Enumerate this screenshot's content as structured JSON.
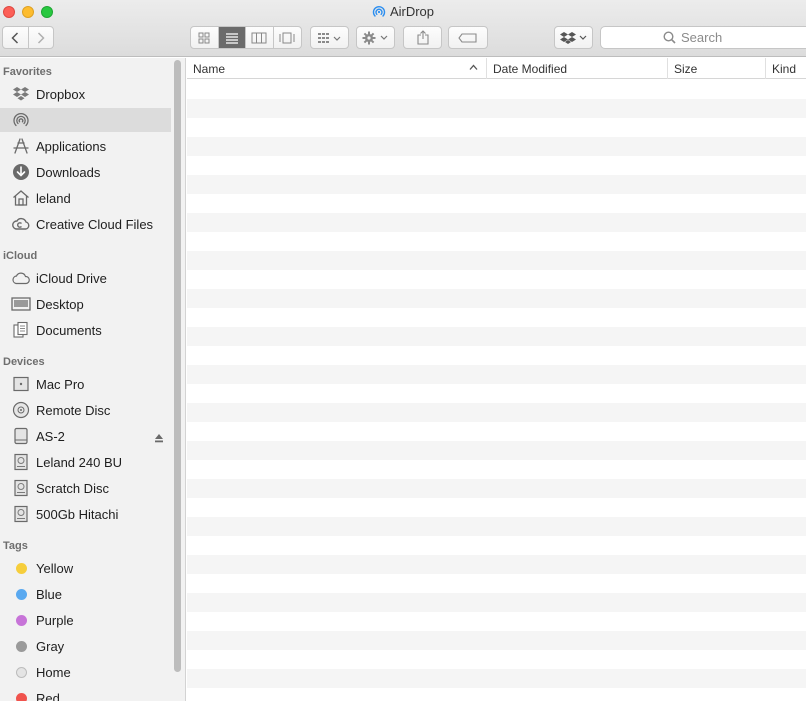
{
  "window": {
    "title": "AirDrop",
    "title_icon": "airdrop-icon"
  },
  "toolbar": {
    "back_icon": "chevron-left-icon",
    "forward_icon": "chevron-right-icon",
    "view_modes": [
      "icon-view",
      "list-view",
      "column-view",
      "cover-flow-view"
    ],
    "active_view": "list-view",
    "arrange_icon": "arrange-grid-icon",
    "action_icon": "gear-icon",
    "share_icon": "share-icon",
    "tag_icon": "tag-icon",
    "dropbox_icon": "dropbox-icon",
    "search_placeholder": "Search"
  },
  "sidebar": {
    "favorites_header": "Favorites",
    "favorites": [
      {
        "label": "Dropbox",
        "icon": "dropbox-icon"
      },
      {
        "label": "",
        "icon": "airdrop-icon",
        "selected": true
      },
      {
        "label": "Applications",
        "icon": "applications-icon"
      },
      {
        "label": "Downloads",
        "icon": "download-icon"
      },
      {
        "label": "leland",
        "icon": "home-icon"
      },
      {
        "label": "Creative Cloud Files",
        "icon": "creative-cloud-icon"
      }
    ],
    "icloud_header": "iCloud",
    "icloud": [
      {
        "label": "iCloud Drive",
        "icon": "cloud-icon"
      },
      {
        "label": "Desktop",
        "icon": "desktop-icon"
      },
      {
        "label": "Documents",
        "icon": "documents-icon"
      }
    ],
    "devices_header": "Devices",
    "devices": [
      {
        "label": "Mac Pro",
        "icon": "mac-pro-icon"
      },
      {
        "label": "Remote Disc",
        "icon": "disc-icon"
      },
      {
        "label": "AS-2",
        "icon": "drive-icon",
        "eject": true
      },
      {
        "label": "Leland 240 BU",
        "icon": "hard-disk-icon"
      },
      {
        "label": "Scratch Disc",
        "icon": "hard-disk-icon"
      },
      {
        "label": "500Gb Hitachi",
        "icon": "hard-disk-icon"
      }
    ],
    "tags_header": "Tags",
    "tags": [
      {
        "label": "Yellow",
        "color": "#f6ce3c"
      },
      {
        "label": "Blue",
        "color": "#5aa9f0"
      },
      {
        "label": "Purple",
        "color": "#c774d8"
      },
      {
        "label": "Gray",
        "color": "#9a9a9a"
      },
      {
        "label": "Home",
        "color": "#e4e4e4"
      },
      {
        "label": "Red",
        "color": "#f0534d"
      }
    ]
  },
  "list": {
    "columns": [
      "Name",
      "Date Modified",
      "Size",
      "Kind"
    ],
    "sorted_column": "Name",
    "rows": []
  }
}
